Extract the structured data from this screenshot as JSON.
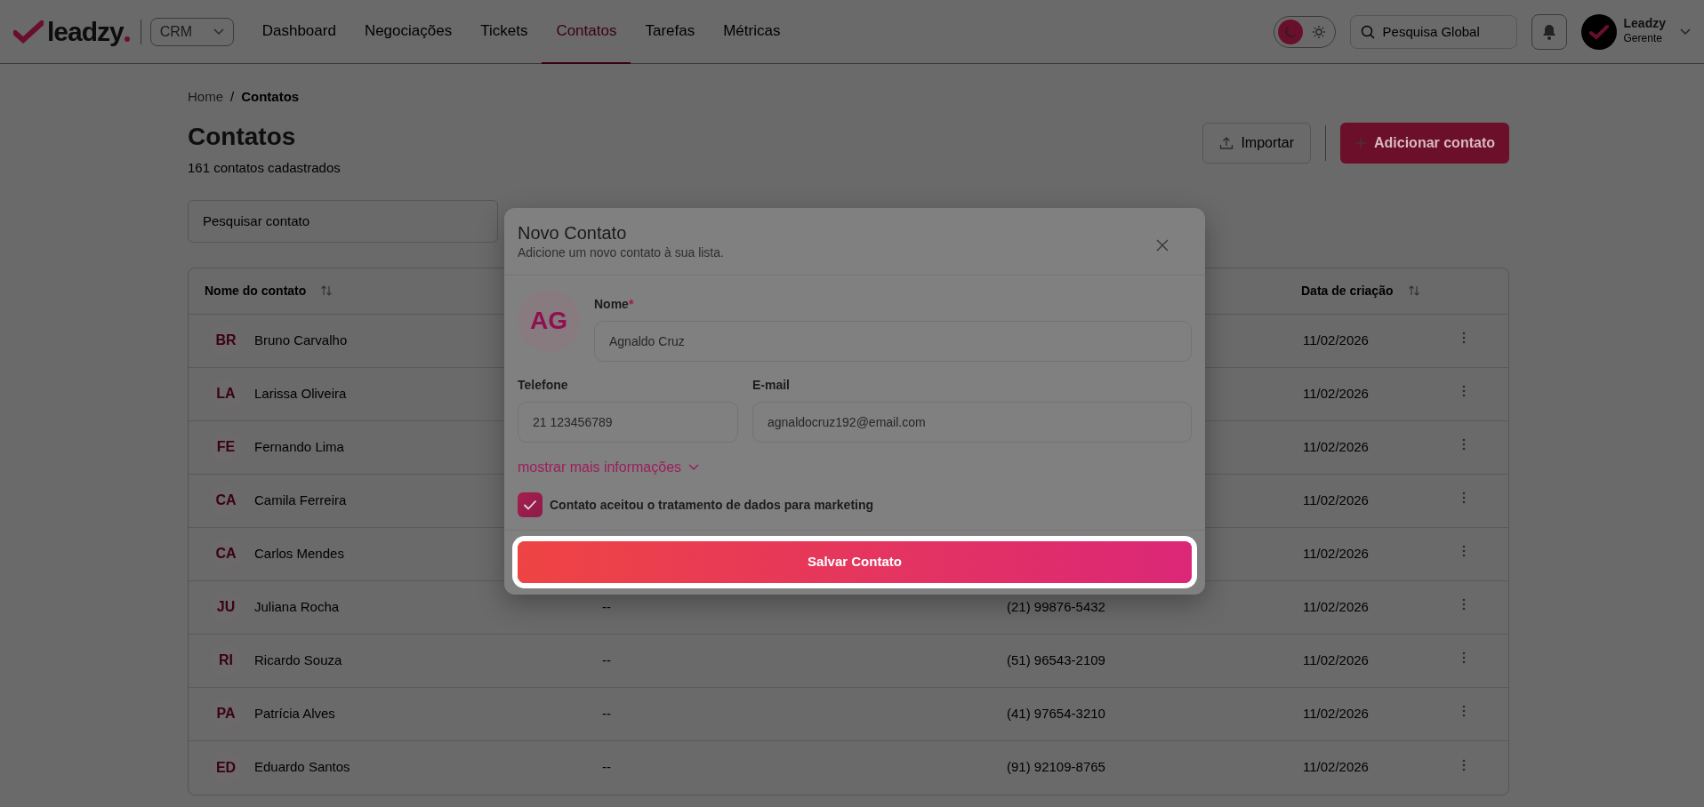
{
  "brand": {
    "logo_text": "leadzy",
    "module": "CRM"
  },
  "nav": [
    {
      "label": "Dashboard",
      "selected": false
    },
    {
      "label": "Negociações",
      "selected": false
    },
    {
      "label": "Tickets",
      "selected": false
    },
    {
      "label": "Contatos",
      "selected": true
    },
    {
      "label": "Tarefas",
      "selected": false
    },
    {
      "label": "Métricas",
      "selected": false
    }
  ],
  "header": {
    "theme_options": [
      {
        "kind": "moon",
        "selected": true
      },
      {
        "kind": "sun",
        "selected": false
      }
    ],
    "search_placeholder": "Pesquisa Global",
    "user_name": "Leadzy",
    "user_role": "Gerente"
  },
  "breadcrumb": [
    {
      "label": "Home",
      "current": false
    },
    {
      "label": "Contatos",
      "current": true
    }
  ],
  "breadcrumb_separator": "/",
  "page": {
    "title": "Contatos",
    "subtitle": "161 contatos cadastrados",
    "import_button": "Importar",
    "add_button": "Adicionar contato",
    "search_placeholder": "Pesquisar contato"
  },
  "table": {
    "header": {
      "column_1": "Nome do contato",
      "column_4": "Data de criação"
    },
    "rows": [
      {
        "initials": "BR",
        "name": "Bruno Carvalho",
        "date": "11/02/2026"
      },
      {
        "initials": "LA",
        "name": "Larissa Oliveira",
        "date": "11/02/2026"
      },
      {
        "initials": "FE",
        "name": "Fernando Lima",
        "date": "11/02/2026"
      },
      {
        "initials": "CA",
        "name": "Camila Ferreira",
        "date": "11/02/2026"
      },
      {
        "initials": "CA",
        "name": "Carlos Mendes",
        "date": "11/02/2026"
      },
      {
        "initials": "JU",
        "name": "Juliana Rocha",
        "column_2": "--",
        "phone": "(21) 99876-5432",
        "date": "11/02/2026"
      },
      {
        "initials": "RI",
        "name": "Ricardo Souza",
        "column_2": "--",
        "phone": "(51) 96543-2109",
        "date": "11/02/2026"
      },
      {
        "initials": "PA",
        "name": "Patrícia Alves",
        "column_2": "--",
        "phone": "(41) 97654-3210",
        "date": "11/02/2026"
      },
      {
        "initials": "ED",
        "name": "Eduardo Santos",
        "column_2": "--",
        "phone": "(91) 92109-8765",
        "date": "11/02/2026"
      }
    ]
  },
  "modal": {
    "title": "Novo Contato",
    "subtitle": "Adicione um novo contato à sua lista.",
    "avatar_initials": "AG",
    "fields": [
      {
        "label": "Nome",
        "required_mark": "*",
        "value": "Agnaldo Cruz"
      },
      {
        "label": "Telefone",
        "value": "21 123456789"
      },
      {
        "label": "E-mail",
        "value": "agnaldocruz192@email.com"
      }
    ],
    "more_link": "mostrar mais informações",
    "consent": {
      "label": "Contato aceitou o tratamento de dados para marketing",
      "checked": true
    },
    "save_button": {
      "label": "Salvar Contato",
      "highlighted": true
    }
  }
}
